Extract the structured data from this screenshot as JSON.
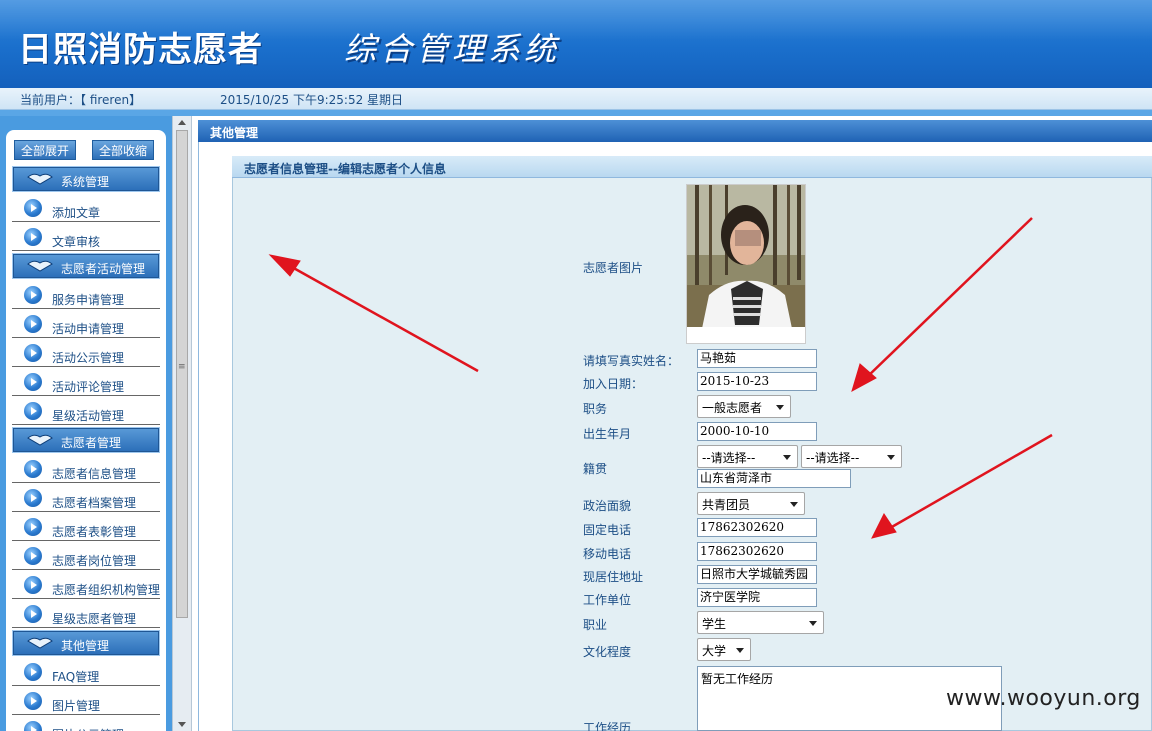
{
  "header": {
    "logo_title": "日照消防志愿者",
    "system_title": "综合管理系统"
  },
  "userbar": {
    "current_user": "当前用户：【 fireren】",
    "datetime": "2015/10/25 下午9:25:52 星期日"
  },
  "sidebar": {
    "expand_all": "全部展开",
    "collapse_all": "全部收缩",
    "groups": [
      {
        "label": "系统管理",
        "items": [
          "添加文章",
          "文章审核"
        ]
      },
      {
        "label": "志愿者活动管理",
        "items": [
          "服务申请管理",
          "活动申请管理",
          "活动公示管理",
          "活动评论管理",
          "星级活动管理"
        ]
      },
      {
        "label": "志愿者管理",
        "items": [
          "志愿者信息管理",
          "志愿者档案管理",
          "志愿者表彰管理",
          "志愿者岗位管理",
          "志愿者组织机构管理",
          "星级志愿者管理"
        ]
      },
      {
        "label": "其他管理",
        "items": [
          "FAQ管理",
          "图片管理",
          "图片公示管理"
        ]
      }
    ]
  },
  "main": {
    "section_title": "其他管理",
    "panel_title": "志愿者信息管理--编辑志愿者个人信息"
  },
  "form": {
    "photo_label": "志愿者图片",
    "name_label": "请填写真实姓名：",
    "name_value": "马艳茹",
    "join_date_label": "加入日期：",
    "join_date_value": "2015-10-23",
    "position_label": "职务",
    "position_value": "一般志愿者",
    "birth_label": "出生年月",
    "birth_value": "2000-10-10",
    "origin_label": "籍贯",
    "origin_select1": "--请选择--",
    "origin_select2": "--请选择--",
    "origin_value": "山东省菏泽市",
    "political_label": "政治面貌",
    "political_value": "共青团员",
    "phone_label": "固定电话",
    "phone_value": "17862302620",
    "mobile_label": "移动电话",
    "mobile_value": "17862302620",
    "address_label": "现居住地址",
    "address_value": "日照市大学城毓秀园",
    "workplace_label": "工作单位",
    "workplace_value": "济宁医学院",
    "occupation_label": "职业",
    "occupation_value": "学生",
    "education_label": "文化程度",
    "education_value": "大学",
    "experience_label": "工作经历",
    "experience_value": "暂无工作经历"
  },
  "watermark": "www.wooyun.org",
  "colors": {
    "header_blue": "#1a6fcc",
    "label_blue": "#1d4f86",
    "arrow_red": "#e0141e"
  }
}
